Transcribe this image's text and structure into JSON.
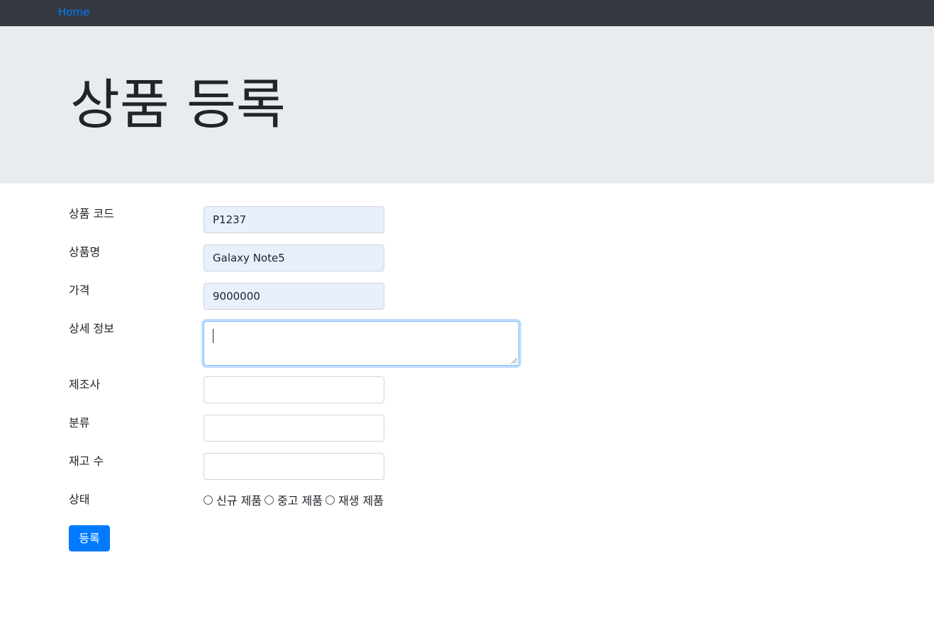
{
  "nav": {
    "home_label": "Home"
  },
  "header": {
    "title": "상품 등록"
  },
  "form": {
    "product_code": {
      "label": "상품 코드",
      "value": "P1237"
    },
    "product_name": {
      "label": "상품명",
      "value": "Galaxy Note5"
    },
    "price": {
      "label": "가격",
      "value": "9000000"
    },
    "description": {
      "label": "상세 정보",
      "value": ""
    },
    "manufacturer": {
      "label": "제조사",
      "value": ""
    },
    "category": {
      "label": "분류",
      "value": ""
    },
    "stock": {
      "label": "재고 수",
      "value": ""
    },
    "condition": {
      "label": "상태",
      "options": [
        "신규 제품",
        "중고 제품",
        "재생 제품"
      ]
    },
    "submit_label": "등록"
  },
  "colors": {
    "navbar": "#343a40",
    "link": "#007bff",
    "jumbotron": "#e9ecef",
    "autofill": "#e8f0fe",
    "primary": "#007bff"
  }
}
